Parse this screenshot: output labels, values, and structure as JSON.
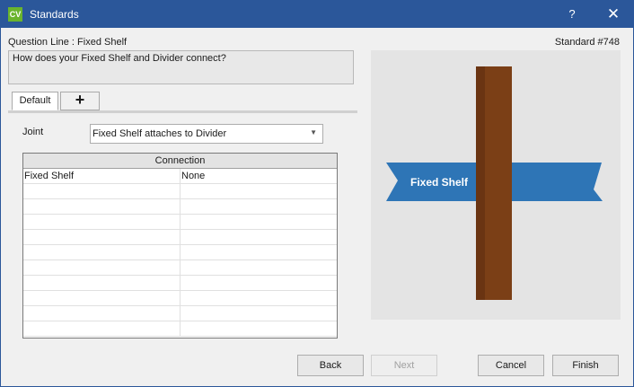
{
  "window": {
    "title": "Standards",
    "app_icon": "CV",
    "help": "?",
    "close": "✕"
  },
  "header": {
    "question_line": "Question Line : Fixed Shelf",
    "standard": "Standard #748"
  },
  "question": "How does your Fixed Shelf and Divider connect?",
  "tabs": [
    {
      "label": "Default"
    },
    {
      "label": "+"
    }
  ],
  "joint": {
    "label": "Joint",
    "value": "Fixed Shelf attaches to Divider"
  },
  "grid": {
    "header": "Connection",
    "rows": [
      {
        "name": "Fixed Shelf",
        "value": "None"
      }
    ],
    "empty_rows": 10
  },
  "preview": {
    "shelf_label": "Fixed Shelf",
    "shelf_color": "#2e75b6",
    "divider_color": "#7b3f16"
  },
  "buttons": {
    "back": "Back",
    "next": "Next",
    "cancel": "Cancel",
    "finish": "Finish"
  }
}
